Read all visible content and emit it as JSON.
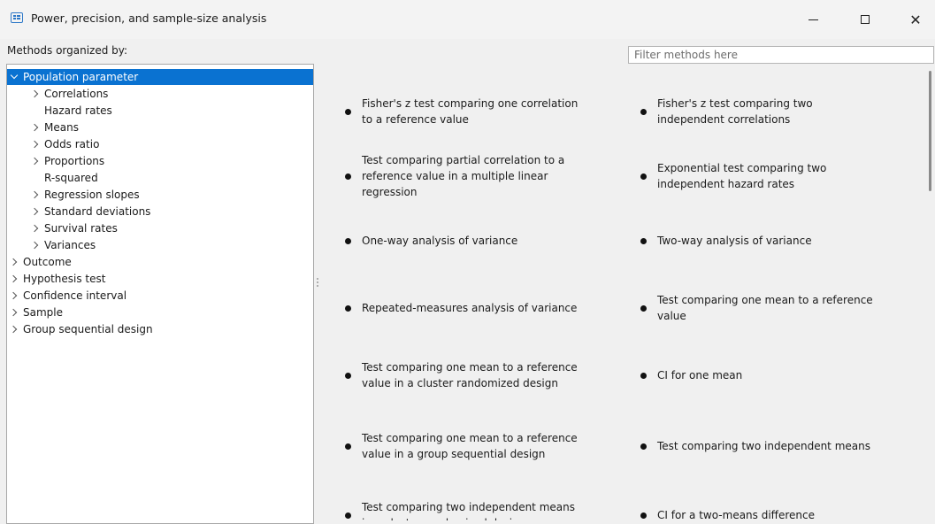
{
  "window": {
    "title": "Power, precision, and sample-size analysis"
  },
  "header": {
    "methods_label": "Methods organized by:",
    "filter_placeholder": "Filter methods here"
  },
  "tree": [
    {
      "label": "Population parameter",
      "level": 0,
      "chevron": "down",
      "selected": true
    },
    {
      "label": "Correlations",
      "level": 1,
      "chevron": "right"
    },
    {
      "label": "Hazard rates",
      "level": 1,
      "chevron": "none"
    },
    {
      "label": "Means",
      "level": 1,
      "chevron": "right"
    },
    {
      "label": "Odds ratio",
      "level": 1,
      "chevron": "right"
    },
    {
      "label": "Proportions",
      "level": 1,
      "chevron": "right"
    },
    {
      "label": "R-squared",
      "level": 1,
      "chevron": "none"
    },
    {
      "label": "Regression slopes",
      "level": 1,
      "chevron": "right"
    },
    {
      "label": "Standard deviations",
      "level": 1,
      "chevron": "right"
    },
    {
      "label": "Survival rates",
      "level": 1,
      "chevron": "right"
    },
    {
      "label": "Variances",
      "level": 1,
      "chevron": "right"
    },
    {
      "label": "Outcome",
      "level": 0,
      "chevron": "right"
    },
    {
      "label": "Hypothesis test",
      "level": 0,
      "chevron": "right"
    },
    {
      "label": "Confidence interval",
      "level": 0,
      "chevron": "right"
    },
    {
      "label": "Sample",
      "level": 0,
      "chevron": "right"
    },
    {
      "label": "Group sequential design",
      "level": 0,
      "chevron": "right"
    }
  ],
  "methods": [
    [
      "Fisher's z test comparing one correlation",
      "to a reference value"
    ],
    [
      "Fisher's z test comparing two",
      "independent correlations"
    ],
    [
      "Test comparing partial correlation to a",
      "reference value in a multiple linear",
      "regression"
    ],
    [
      "Exponential test comparing two",
      "independent hazard rates"
    ],
    [
      "One-way analysis of variance"
    ],
    [
      "Two-way analysis of variance"
    ],
    [
      "Repeated-measures analysis of variance"
    ],
    [
      "Test comparing one mean to a reference",
      "value"
    ],
    [
      "Test comparing one mean to a reference",
      "value in a cluster randomized design"
    ],
    [
      "CI for one mean"
    ],
    [
      "Test comparing one mean to a reference",
      "value in a group sequential design"
    ],
    [
      "Test comparing two independent means"
    ],
    [
      "Test comparing two independent means",
      "in a cluster randomized design"
    ],
    [
      "CI for a two-means difference"
    ]
  ]
}
